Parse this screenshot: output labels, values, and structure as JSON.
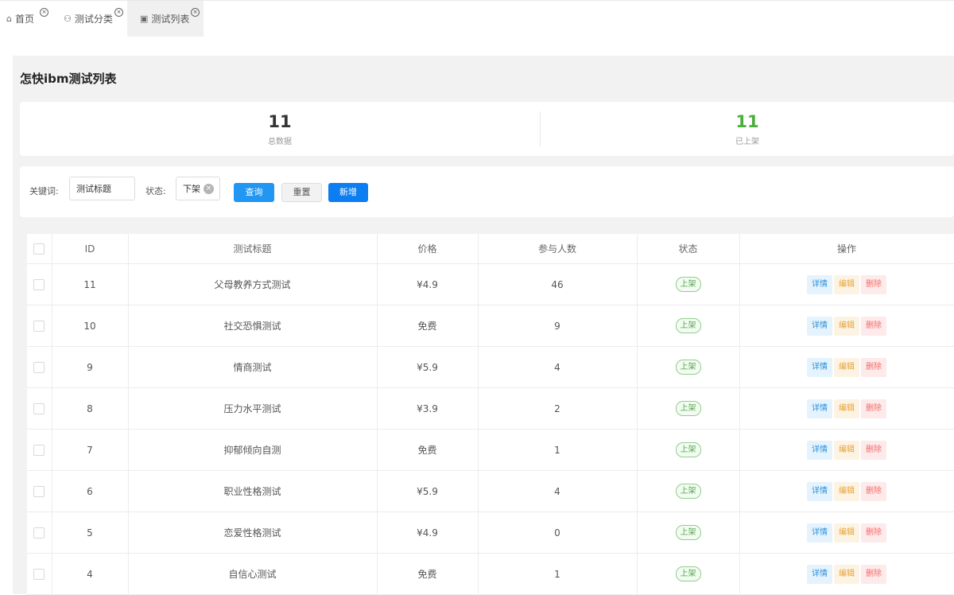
{
  "tabs": [
    {
      "icon": "home-icon",
      "glyph": "⌂",
      "label": "首页"
    },
    {
      "icon": "category-icon",
      "glyph": "⚇",
      "label": "测试分类"
    },
    {
      "icon": "list-icon",
      "glyph": "▣",
      "label": "测试列表"
    }
  ],
  "page": {
    "title": "怎快ibm测试列表"
  },
  "stats": [
    {
      "value": "11",
      "label": "总数据",
      "color": "#333333"
    },
    {
      "value": "11",
      "label": "已上架",
      "color": "#4cae3c"
    }
  ],
  "search": {
    "keyword_label": "关键词:",
    "keyword_value": "测试标题",
    "status_label": "状态:",
    "status_value": "下架",
    "query_btn": "查询",
    "reset_btn": "重置",
    "add_btn": "新增"
  },
  "table": {
    "columns": [
      "ID",
      "测试标题",
      "价格",
      "参与人数",
      "状态",
      "操作"
    ],
    "actions": {
      "detail": "详情",
      "edit": "编辑",
      "delete": "删除"
    },
    "rows": [
      {
        "id": "11",
        "title": "父母教养方式测试",
        "price": "¥4.9",
        "participants": "46",
        "status": "上架"
      },
      {
        "id": "10",
        "title": "社交恐惧测试",
        "price": "免费",
        "participants": "9",
        "status": "上架"
      },
      {
        "id": "9",
        "title": "情商测试",
        "price": "¥5.9",
        "participants": "4",
        "status": "上架"
      },
      {
        "id": "8",
        "title": "压力水平测试",
        "price": "¥3.9",
        "participants": "2",
        "status": "上架"
      },
      {
        "id": "7",
        "title": "抑郁倾向自测",
        "price": "免费",
        "participants": "1",
        "status": "上架"
      },
      {
        "id": "6",
        "title": "职业性格测试",
        "price": "¥5.9",
        "participants": "4",
        "status": "上架"
      },
      {
        "id": "5",
        "title": "恋爱性格测试",
        "price": "¥4.9",
        "participants": "0",
        "status": "上架"
      },
      {
        "id": "4",
        "title": "自信心测试",
        "price": "免费",
        "participants": "1",
        "status": "上架"
      }
    ]
  }
}
